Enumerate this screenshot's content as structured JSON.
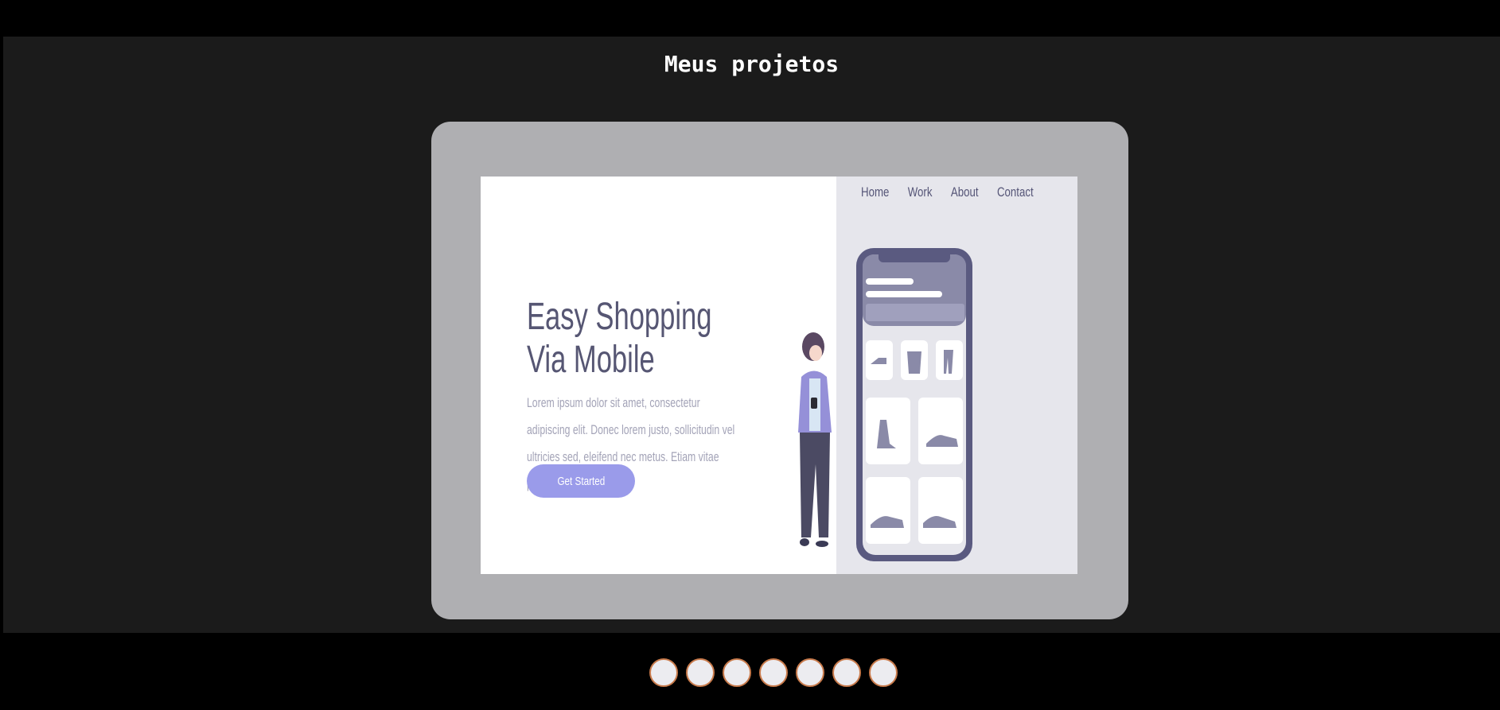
{
  "section": {
    "title": "Meus projetos"
  },
  "project": {
    "nav": [
      "Home",
      "Work",
      "About",
      "Contact"
    ],
    "hero_title_line1": "Easy Shopping",
    "hero_title_line2": "Via Mobile",
    "hero_text": "Lorem ipsum dolor sit amet, consectetur adipiscing elit. Donec lorem justo, sollicitudin vel ultricies sed, eleifend nec metus. Etiam vitae pellentesque dolor.",
    "cta_label": "Get Started"
  },
  "pagination": {
    "count": 7,
    "active_index": 0
  },
  "colors": {
    "page_bg": "#000000",
    "section_bg": "#1b1b1b",
    "frame_bg": "#afafb2",
    "accent": "#9a9bea",
    "heading": "#565673",
    "dot_border": "#c87a4b"
  }
}
